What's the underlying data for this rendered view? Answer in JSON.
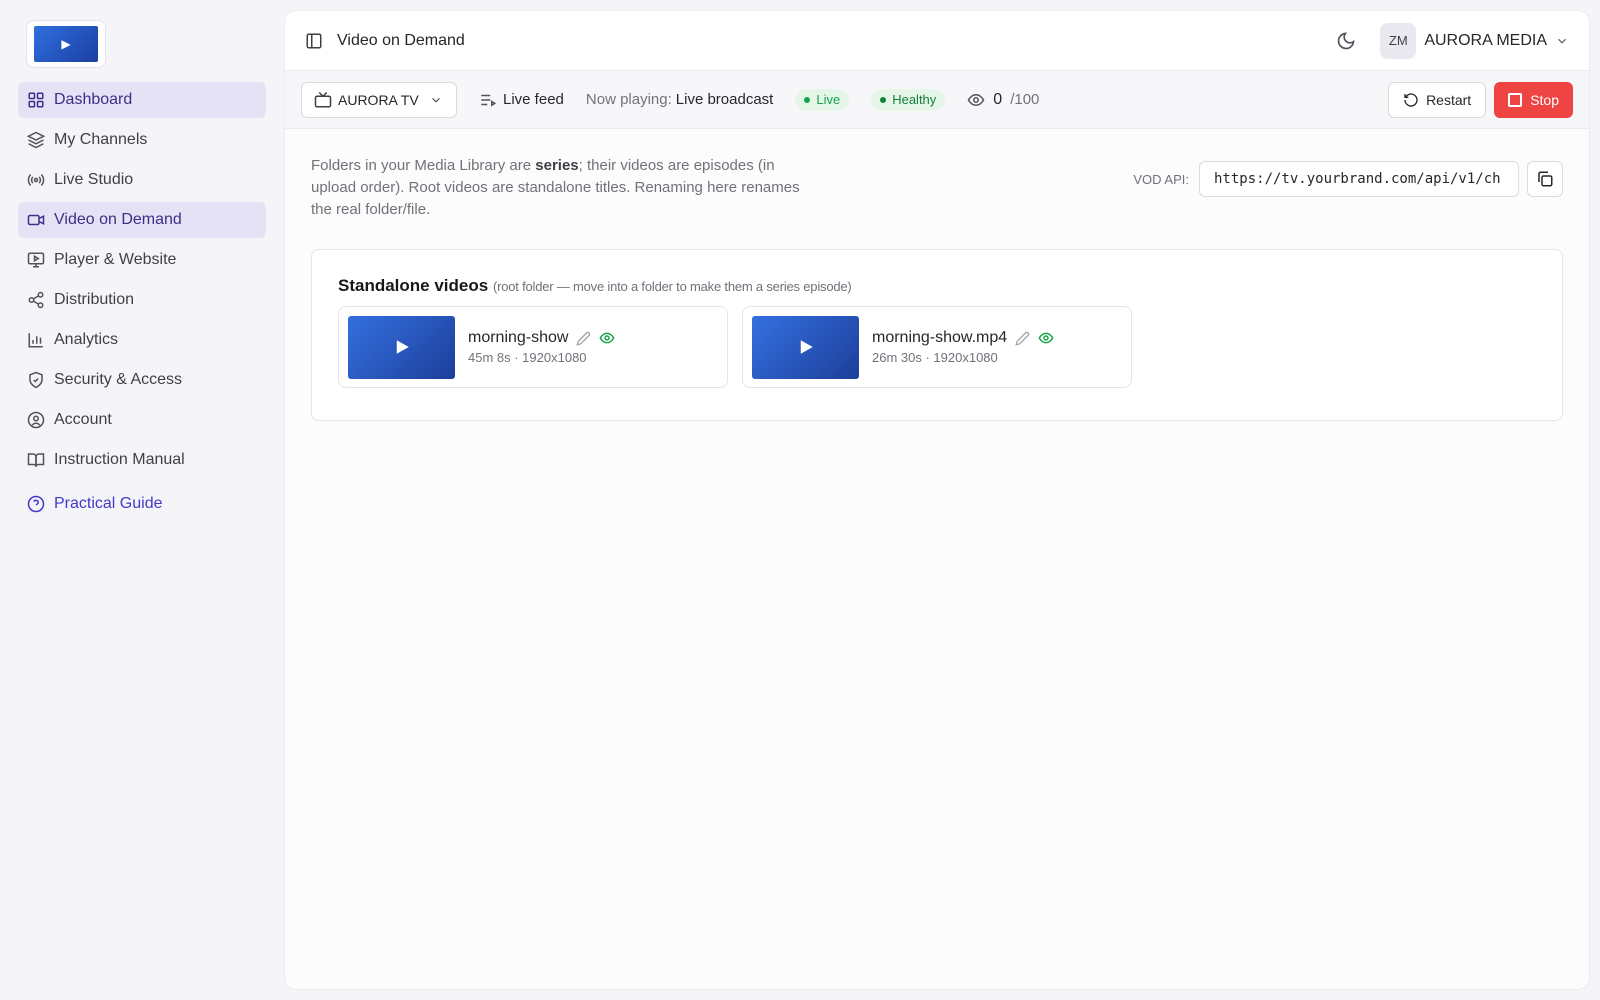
{
  "sidebar": {
    "items": [
      {
        "label": "Dashboard",
        "icon": "dashboard-icon"
      },
      {
        "label": "My Channels",
        "icon": "layers-icon"
      },
      {
        "label": "Live Studio",
        "icon": "broadcast-icon"
      },
      {
        "label": "Video on Demand",
        "icon": "video-camera-icon"
      },
      {
        "label": "Player & Website",
        "icon": "monitor-play-icon"
      },
      {
        "label": "Distribution",
        "icon": "share-icon"
      },
      {
        "label": "Analytics",
        "icon": "bar-chart-icon"
      },
      {
        "label": "Security & Access",
        "icon": "shield-icon"
      },
      {
        "label": "Account",
        "icon": "user-circle-icon"
      },
      {
        "label": "Instruction Manual",
        "icon": "book-icon"
      }
    ],
    "guide_label": "Practical Guide"
  },
  "header": {
    "title": "Video on Demand",
    "avatar_initials": "ZM",
    "org_name": "AURORA MEDIA"
  },
  "statusbar": {
    "channel": "AURORA TV",
    "feed_label": "Live feed",
    "now_playing_label": "Now playing:",
    "now_playing_value": "Live broadcast",
    "live_badge": "Live",
    "health_badge": "Healthy",
    "viewers_current": "0",
    "viewers_max": "/100",
    "restart_label": "Restart",
    "stop_label": "Stop"
  },
  "intro": {
    "part1": "Folders in your Media Library are ",
    "bold": "series",
    "part2": "; their videos are episodes (in upload order). Root videos are standalone titles. Renaming here renames the real folder/file."
  },
  "api": {
    "label": "VOD API:",
    "url": "https://tv.yourbrand.com/api/v1/ch"
  },
  "standalone": {
    "title": "Standalone videos",
    "subtitle": "(root folder — move into a folder to make them a series episode)",
    "videos": [
      {
        "name": "morning-show",
        "meta": "45m 8s · 1920x1080"
      },
      {
        "name": "morning-show.mp4",
        "meta": "26m 30s · 1920x1080"
      }
    ]
  },
  "colors": {
    "accent": "#3b2f8a",
    "stop": "#ef4444",
    "live_green": "#16a34a"
  }
}
